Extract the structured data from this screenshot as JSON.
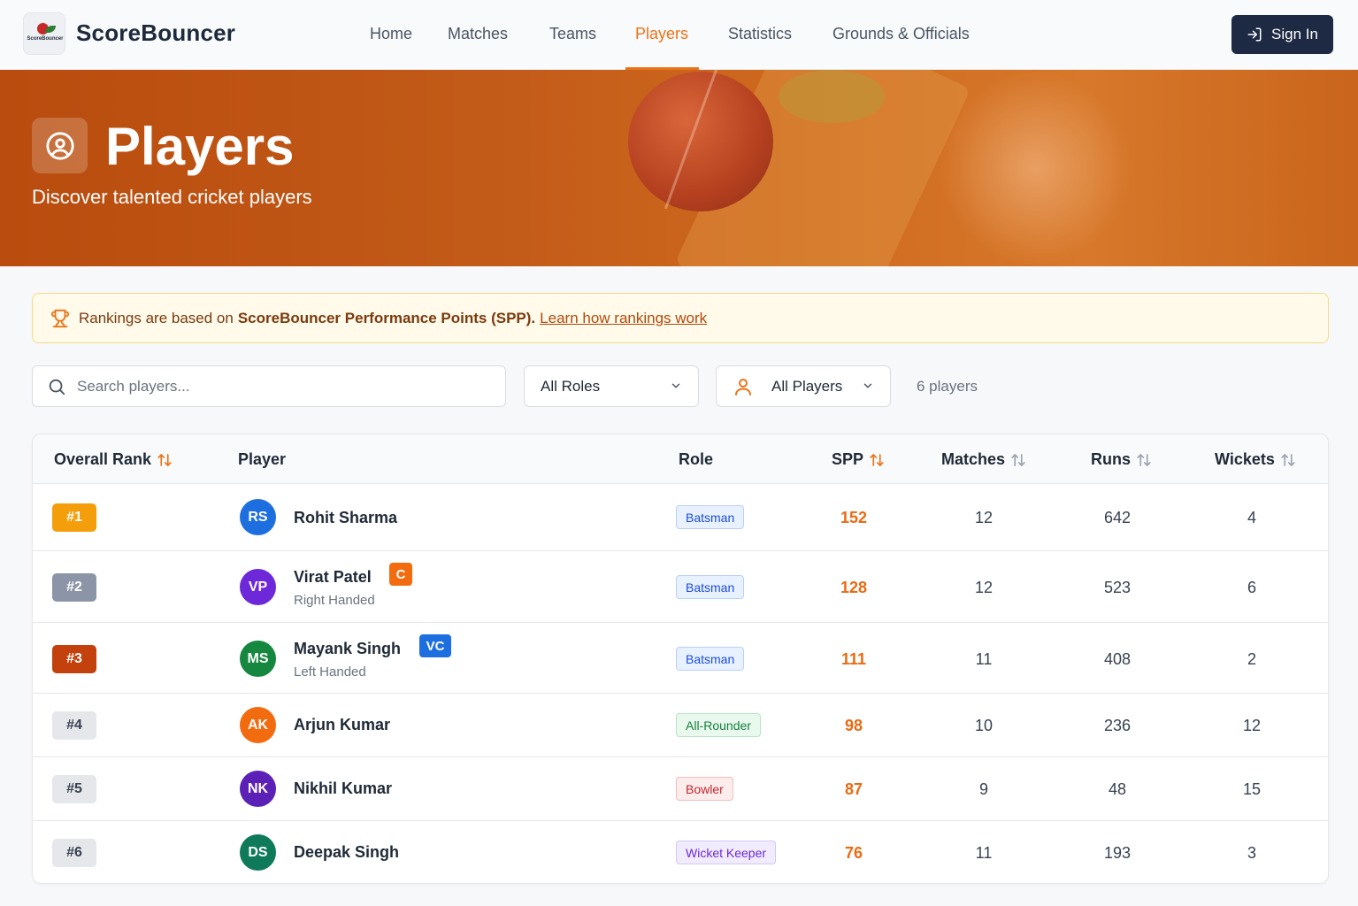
{
  "nav": {
    "brand": "ScoreBouncer",
    "logo_text": "ScoreBouncer",
    "links": [
      "Home",
      "Matches",
      "Teams",
      "Players",
      "Statistics",
      "Grounds & Officials"
    ],
    "active": "Players",
    "signin_label": "Sign In"
  },
  "hero": {
    "title": "Players",
    "subtitle": "Discover talented cricket players"
  },
  "banner": {
    "prefix": "Rankings are based on",
    "bold": "ScoreBouncer Performance Points (SPP).",
    "link": "Learn how rankings work"
  },
  "filters": {
    "search_placeholder": "Search players...",
    "roles_value": "All Roles",
    "players_value": "All Players",
    "count_text": "6 players"
  },
  "table": {
    "headers": {
      "rank": "Overall Rank",
      "player": "Player",
      "role": "Role",
      "spp": "SPP",
      "matches": "Matches",
      "runs": "Runs",
      "wickets": "Wickets"
    },
    "rows": [
      {
        "rank": "#1",
        "initials": "RS",
        "name": "Rohit Sharma",
        "sub": "",
        "badge": "",
        "role": "Batsman",
        "spp": "152",
        "matches": "12",
        "runs": "642",
        "wickets": "4"
      },
      {
        "rank": "#2",
        "initials": "VP",
        "name": "Virat Patel",
        "sub": "Right Handed",
        "badge": "C",
        "role": "Batsman",
        "spp": "128",
        "matches": "12",
        "runs": "523",
        "wickets": "6"
      },
      {
        "rank": "#3",
        "initials": "MS",
        "name": "Mayank Singh",
        "sub": "Left Handed",
        "badge": "VC",
        "role": "Batsman",
        "spp": "111",
        "matches": "11",
        "runs": "408",
        "wickets": "2"
      },
      {
        "rank": "#4",
        "initials": "AK",
        "name": "Arjun Kumar",
        "sub": "",
        "badge": "",
        "role": "All-Rounder",
        "spp": "98",
        "matches": "10",
        "runs": "236",
        "wickets": "12"
      },
      {
        "rank": "#5",
        "initials": "NK",
        "name": "Nikhil Kumar",
        "sub": "",
        "badge": "",
        "role": "Bowler",
        "spp": "87",
        "matches": "9",
        "runs": "48",
        "wickets": "15"
      },
      {
        "rank": "#6",
        "initials": "DS",
        "name": "Deepak Singh",
        "sub": "",
        "badge": "",
        "role": "Wicket Keeper",
        "spp": "76",
        "matches": "11",
        "runs": "193",
        "wickets": "3"
      }
    ]
  },
  "colors": {
    "accent": "#ea7317",
    "rank_gold": "#f59e0b",
    "rank_silver": "#8b95a7",
    "rank_bronze": "#c2410c",
    "rank_default": "#e5e7eb",
    "avatar_rs": "#1d6fe0",
    "avatar_vp": "#6d28d9",
    "avatar_ms": "#15873f",
    "avatar_ak": "#f26b0f",
    "avatar_nk": "#5b21b6",
    "avatar_ds": "#0f7a5a"
  }
}
